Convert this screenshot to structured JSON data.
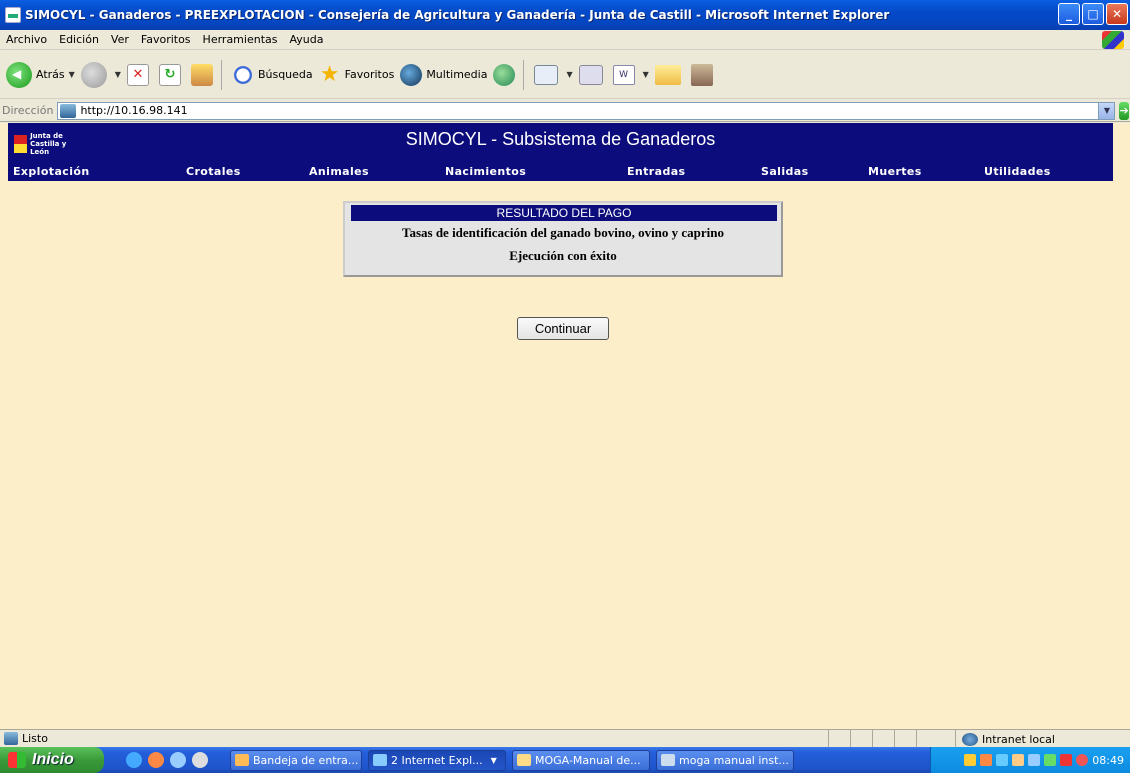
{
  "window": {
    "title": "SIMOCYL - Ganaderos - PREEXPLOTACION - Consejería de Agricultura y Ganadería - Junta de Castill - Microsoft Internet Explorer"
  },
  "menu": [
    "Archivo",
    "Edición",
    "Ver",
    "Favoritos",
    "Herramientas",
    "Ayuda"
  ],
  "toolbar": {
    "back_label": "Atrás",
    "search_label": "Búsqueda",
    "favorites_label": "Favoritos",
    "media_label": "Multimedia"
  },
  "address": {
    "label": "Dirección",
    "url": "http://10.16.98.141",
    "go_label": "Ir"
  },
  "app": {
    "logo_line1": "Junta de",
    "logo_line2": "Castilla y León",
    "title": "SIMOCYL - Subsistema de Ganaderos",
    "nav": [
      "Explotación",
      "Crotales",
      "Animales",
      "Nacimientos",
      "Entradas",
      "Salidas",
      "Muertes",
      "Utilidades"
    ]
  },
  "result": {
    "heading": "RESULTADO DEL PAGO",
    "description": "Tasas de identificación del ganado bovino, ovino y caprino",
    "status": "Ejecución con éxito",
    "continue_label": "Continuar"
  },
  "status": {
    "text": "Listo",
    "zone": "Intranet local"
  },
  "taskbar": {
    "start_label": "Inicio",
    "tasks": [
      "Bandeja de entra...",
      "2 Internet Expl...",
      "MOGA-Manual de...",
      "moga manual inst..."
    ],
    "clock": "08:49"
  }
}
